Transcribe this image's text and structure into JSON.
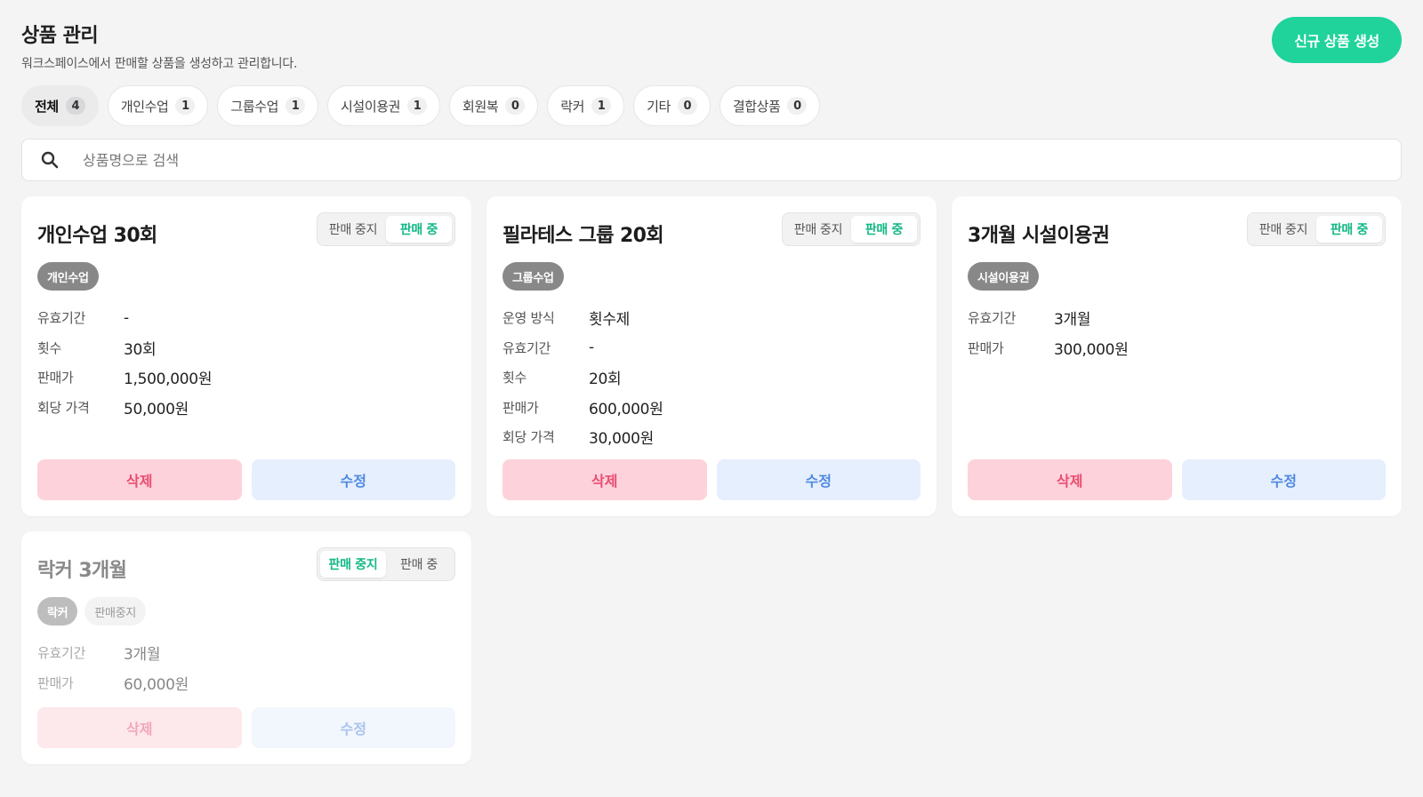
{
  "header": {
    "title": "상품 관리",
    "subtitle": "워크스페이스에서 판매할 상품을 생성하고 관리합니다.",
    "create_label": "신규 상품 생성"
  },
  "tabs": [
    {
      "label": "전체",
      "count": "4",
      "active": true
    },
    {
      "label": "개인수업",
      "count": "1"
    },
    {
      "label": "그룹수업",
      "count": "1"
    },
    {
      "label": "시설이용권",
      "count": "1"
    },
    {
      "label": "회원복",
      "count": "0"
    },
    {
      "label": "락커",
      "count": "1"
    },
    {
      "label": "기타",
      "count": "0"
    },
    {
      "label": "결합상품",
      "count": "0"
    }
  ],
  "search": {
    "placeholder": "상품명으로 검색",
    "value": ""
  },
  "toggle_labels": {
    "off": "판매 중지",
    "on": "판매 중"
  },
  "actions": {
    "delete": "삭제",
    "edit": "수정"
  },
  "products": [
    {
      "title": "개인수업 30회",
      "status": "판매 중",
      "tags": [
        "개인수업"
      ],
      "fields": [
        {
          "k": "유효기간",
          "v": "-"
        },
        {
          "k": "횟수",
          "v": "30회"
        },
        {
          "k": "판매가",
          "v": "1,500,000원"
        },
        {
          "k": "회당 가격",
          "v": "50,000원"
        }
      ]
    },
    {
      "title": "필라테스 그룹 20회",
      "status": "판매 중",
      "tags": [
        "그룹수업"
      ],
      "fields": [
        {
          "k": "운영 방식",
          "v": "횟수제"
        },
        {
          "k": "유효기간",
          "v": "-"
        },
        {
          "k": "횟수",
          "v": "20회"
        },
        {
          "k": "판매가",
          "v": "600,000원"
        },
        {
          "k": "회당 가격",
          "v": "30,000원"
        }
      ]
    },
    {
      "title": "3개월 시설이용권",
      "status": "판매 중",
      "tags": [
        "시설이용권"
      ],
      "fields": [
        {
          "k": "유효기간",
          "v": "3개월"
        },
        {
          "k": "판매가",
          "v": "300,000원"
        }
      ]
    },
    {
      "title": "락커 3개월",
      "status": "판매 중지",
      "tags": [
        "락커",
        "판매중지"
      ],
      "fields": [
        {
          "k": "유효기간",
          "v": "3개월"
        },
        {
          "k": "판매가",
          "v": "60,000원"
        }
      ]
    }
  ],
  "colors": {
    "accent": "#1fd39b",
    "toggle_on_text": "#12b886",
    "delete_bg": "#fdd2db",
    "delete_text": "#e94d71",
    "edit_bg": "#e6effd",
    "edit_text": "#4f89e0",
    "tag_bg": "#888888"
  },
  "icons": {
    "search": "search-icon"
  }
}
